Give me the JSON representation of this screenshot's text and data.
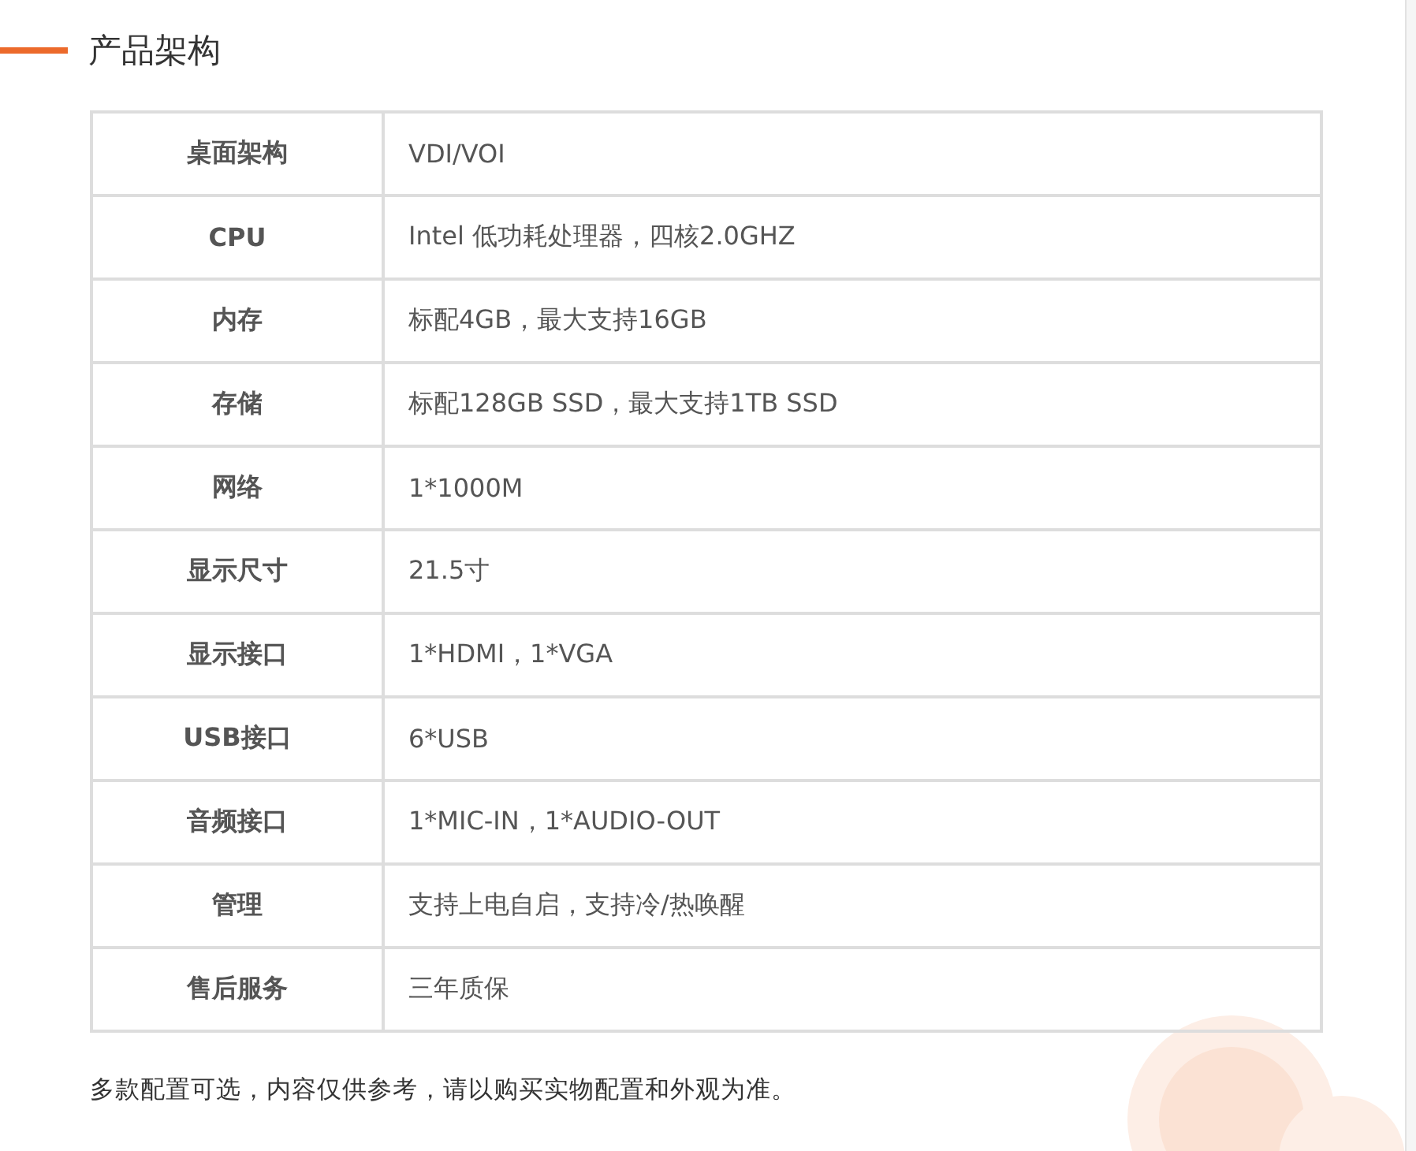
{
  "section": {
    "title": "产品架构"
  },
  "table": {
    "rows": [
      {
        "label": "桌面架构",
        "value": "VDI/VOI"
      },
      {
        "label": "CPU",
        "value": "Intel 低功耗处理器，四核2.0GHZ"
      },
      {
        "label": "内存",
        "value": "标配4GB，最大支持16GB"
      },
      {
        "label": "存储",
        "value": "标配128GB SSD，最大支持1TB SSD"
      },
      {
        "label": "网络",
        "value": "1*1000M"
      },
      {
        "label": "显示尺寸",
        "value": "21.5寸"
      },
      {
        "label": "显示接口",
        "value": "1*HDMI，1*VGA"
      },
      {
        "label": "USB接口",
        "value": "6*USB"
      },
      {
        "label": "音频接口",
        "value": "1*MIC-IN，1*AUDIO-OUT"
      },
      {
        "label": "管理",
        "value": "支持上电自启，支持冷/热唤醒"
      },
      {
        "label": "售后服务",
        "value": "三年质保"
      }
    ]
  },
  "note": "多款配置可选，内容仅供参考，请以购买实物配置和外观为准。"
}
